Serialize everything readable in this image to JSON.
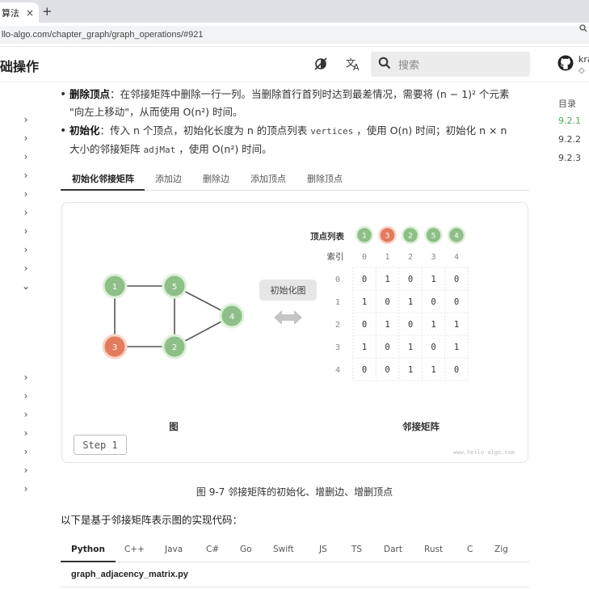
{
  "browser": {
    "tab_title": "算法",
    "tab_close": "×",
    "new_tab": "+",
    "url": "llo-algo.com/chapter_graph/graph_operations/#921"
  },
  "header": {
    "title": "础操作",
    "search_placeholder": "搜索",
    "repo_name": "kra",
    "repo_sub": "◇"
  },
  "toc": {
    "title": "目录",
    "items": [
      {
        "label": "9.2.1",
        "active": true
      },
      {
        "label": "9.2.2",
        "active": false
      },
      {
        "label": "9.2.3",
        "active": false
      }
    ]
  },
  "content": {
    "bullet1": {
      "term": "删除顶点",
      "line1": "：在邻接矩阵中删除一行一列。当删除首行首列时达到最差情况，需要将 (n − 1)² 个元素",
      "line2": "\"向左上移动\"，从而使用 O(n²) 时间。"
    },
    "bullet2": {
      "term": "初始化",
      "line1a": "：传入 n 个顶点，初始化长度为 n 的顶点列表 ",
      "code1": "vertices",
      "line1b": " ，使用 O(n) 时间；初始化 n × n",
      "line2a": "大小的邻接矩阵 ",
      "code2": "adjMat",
      "line2b": " ，使用 O(n²) 时间。"
    },
    "tabs": [
      "初始化邻接矩阵",
      "添加边",
      "删除边",
      "添加顶点",
      "删除顶点"
    ],
    "caption": "图 9-7   邻接矩阵的初始化、增删边、增删顶点",
    "paragraph": "以下是基于邻接矩阵表示图的实现代码：",
    "languages": [
      "Python",
      "C++",
      "Java",
      "C#",
      "Go",
      "Swift",
      "JS",
      "TS",
      "Dart",
      "Rust",
      "C",
      "Zig"
    ],
    "filename": "graph_adjacency_matrix.py"
  },
  "figure": {
    "graph_label": "图",
    "matrix_label": "邻接矩阵",
    "vertex_list_label": "顶点列表",
    "index_label": "索引",
    "action_label": "初始化图",
    "step_label": "Step 1",
    "watermark": "www.hello-algo.com",
    "vertices": [
      "1",
      "3",
      "2",
      "5",
      "4"
    ],
    "vertex_highlight": "3",
    "indices": [
      "0",
      "1",
      "2",
      "3",
      "4"
    ],
    "matrix": [
      [
        0,
        1,
        0,
        1,
        0
      ],
      [
        1,
        0,
        1,
        0,
        0
      ],
      [
        0,
        1,
        0,
        1,
        1
      ],
      [
        1,
        0,
        1,
        0,
        1
      ],
      [
        0,
        0,
        1,
        1,
        0
      ]
    ],
    "edges": [
      [
        "1",
        "5"
      ],
      [
        "1",
        "3"
      ],
      [
        "3",
        "2"
      ],
      [
        "5",
        "2"
      ],
      [
        "5",
        "4"
      ],
      [
        "2",
        "4"
      ]
    ],
    "colors": {
      "vertex_fill": "#8fbf88",
      "vertex_stroke": "#dff0dc",
      "highlight_fill": "#e37c5d",
      "highlight_stroke": "#f7d5c9",
      "edge": "#555555",
      "arrow": "#c5c5c5"
    }
  },
  "icons": {
    "search": "search-icon",
    "translate": "translate-icon",
    "theme": "theme-toggle-icon",
    "github": "github-icon"
  }
}
